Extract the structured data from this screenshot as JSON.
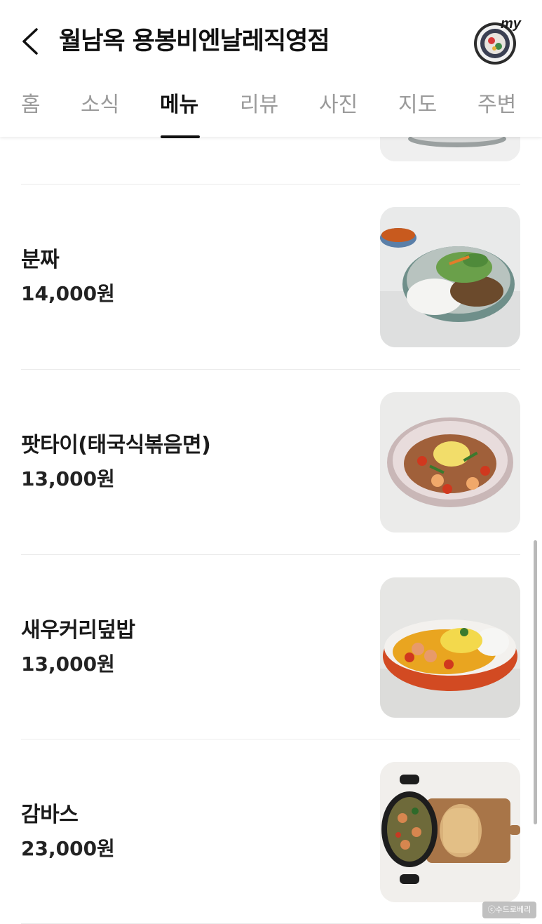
{
  "header": {
    "title": "월남옥 용봉비엔날레직영점",
    "my_badge": "my"
  },
  "tabs": [
    {
      "label": "홈"
    },
    {
      "label": "소식"
    },
    {
      "label": "메뉴",
      "active": true
    },
    {
      "label": "리뷰"
    },
    {
      "label": "사진"
    },
    {
      "label": "지도"
    },
    {
      "label": "주변"
    }
  ],
  "menu": [
    {
      "name": "분짜",
      "price": "14,000원",
      "image": "bun-cha-dish"
    },
    {
      "name": "팟타이(태국식볶음면)",
      "price": "13,000원",
      "image": "pad-thai-dish"
    },
    {
      "name": "새우커리덮밥",
      "price": "13,000원",
      "image": "shrimp-curry-rice-dish"
    },
    {
      "name": "감바스",
      "price": "23,000원",
      "image": "gambas-dish"
    }
  ],
  "watermark": "ⓒ수드로베리",
  "colors": {
    "active_tab": "#111111",
    "inactive_tab": "#9a9a9a",
    "divider": "#ebebeb"
  }
}
